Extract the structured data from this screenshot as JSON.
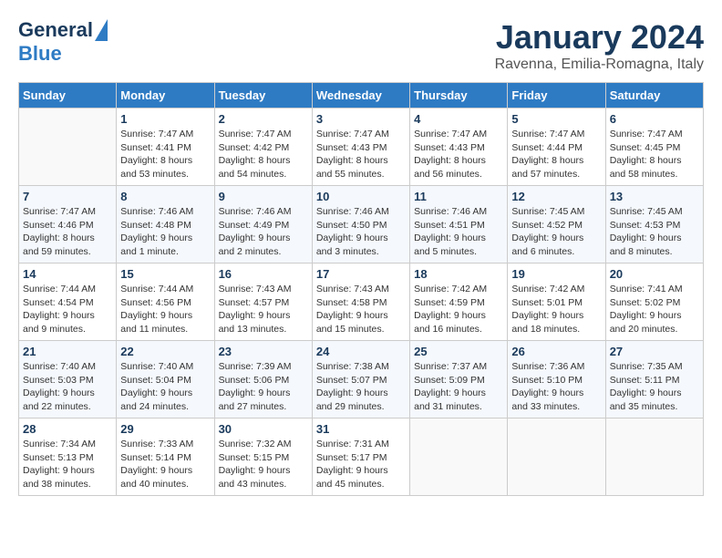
{
  "header": {
    "logo_general": "General",
    "logo_blue": "Blue",
    "month": "January 2024",
    "location": "Ravenna, Emilia-Romagna, Italy"
  },
  "days_of_week": [
    "Sunday",
    "Monday",
    "Tuesday",
    "Wednesday",
    "Thursday",
    "Friday",
    "Saturday"
  ],
  "weeks": [
    [
      {
        "day": "",
        "sunrise": "",
        "sunset": "",
        "daylight": ""
      },
      {
        "day": "1",
        "sunrise": "Sunrise: 7:47 AM",
        "sunset": "Sunset: 4:41 PM",
        "daylight": "Daylight: 8 hours and 53 minutes."
      },
      {
        "day": "2",
        "sunrise": "Sunrise: 7:47 AM",
        "sunset": "Sunset: 4:42 PM",
        "daylight": "Daylight: 8 hours and 54 minutes."
      },
      {
        "day": "3",
        "sunrise": "Sunrise: 7:47 AM",
        "sunset": "Sunset: 4:43 PM",
        "daylight": "Daylight: 8 hours and 55 minutes."
      },
      {
        "day": "4",
        "sunrise": "Sunrise: 7:47 AM",
        "sunset": "Sunset: 4:43 PM",
        "daylight": "Daylight: 8 hours and 56 minutes."
      },
      {
        "day": "5",
        "sunrise": "Sunrise: 7:47 AM",
        "sunset": "Sunset: 4:44 PM",
        "daylight": "Daylight: 8 hours and 57 minutes."
      },
      {
        "day": "6",
        "sunrise": "Sunrise: 7:47 AM",
        "sunset": "Sunset: 4:45 PM",
        "daylight": "Daylight: 8 hours and 58 minutes."
      }
    ],
    [
      {
        "day": "7",
        "sunrise": "Sunrise: 7:47 AM",
        "sunset": "Sunset: 4:46 PM",
        "daylight": "Daylight: 8 hours and 59 minutes."
      },
      {
        "day": "8",
        "sunrise": "Sunrise: 7:46 AM",
        "sunset": "Sunset: 4:48 PM",
        "daylight": "Daylight: 9 hours and 1 minute."
      },
      {
        "day": "9",
        "sunrise": "Sunrise: 7:46 AM",
        "sunset": "Sunset: 4:49 PM",
        "daylight": "Daylight: 9 hours and 2 minutes."
      },
      {
        "day": "10",
        "sunrise": "Sunrise: 7:46 AM",
        "sunset": "Sunset: 4:50 PM",
        "daylight": "Daylight: 9 hours and 3 minutes."
      },
      {
        "day": "11",
        "sunrise": "Sunrise: 7:46 AM",
        "sunset": "Sunset: 4:51 PM",
        "daylight": "Daylight: 9 hours and 5 minutes."
      },
      {
        "day": "12",
        "sunrise": "Sunrise: 7:45 AM",
        "sunset": "Sunset: 4:52 PM",
        "daylight": "Daylight: 9 hours and 6 minutes."
      },
      {
        "day": "13",
        "sunrise": "Sunrise: 7:45 AM",
        "sunset": "Sunset: 4:53 PM",
        "daylight": "Daylight: 9 hours and 8 minutes."
      }
    ],
    [
      {
        "day": "14",
        "sunrise": "Sunrise: 7:44 AM",
        "sunset": "Sunset: 4:54 PM",
        "daylight": "Daylight: 9 hours and 9 minutes."
      },
      {
        "day": "15",
        "sunrise": "Sunrise: 7:44 AM",
        "sunset": "Sunset: 4:56 PM",
        "daylight": "Daylight: 9 hours and 11 minutes."
      },
      {
        "day": "16",
        "sunrise": "Sunrise: 7:43 AM",
        "sunset": "Sunset: 4:57 PM",
        "daylight": "Daylight: 9 hours and 13 minutes."
      },
      {
        "day": "17",
        "sunrise": "Sunrise: 7:43 AM",
        "sunset": "Sunset: 4:58 PM",
        "daylight": "Daylight: 9 hours and 15 minutes."
      },
      {
        "day": "18",
        "sunrise": "Sunrise: 7:42 AM",
        "sunset": "Sunset: 4:59 PM",
        "daylight": "Daylight: 9 hours and 16 minutes."
      },
      {
        "day": "19",
        "sunrise": "Sunrise: 7:42 AM",
        "sunset": "Sunset: 5:01 PM",
        "daylight": "Daylight: 9 hours and 18 minutes."
      },
      {
        "day": "20",
        "sunrise": "Sunrise: 7:41 AM",
        "sunset": "Sunset: 5:02 PM",
        "daylight": "Daylight: 9 hours and 20 minutes."
      }
    ],
    [
      {
        "day": "21",
        "sunrise": "Sunrise: 7:40 AM",
        "sunset": "Sunset: 5:03 PM",
        "daylight": "Daylight: 9 hours and 22 minutes."
      },
      {
        "day": "22",
        "sunrise": "Sunrise: 7:40 AM",
        "sunset": "Sunset: 5:04 PM",
        "daylight": "Daylight: 9 hours and 24 minutes."
      },
      {
        "day": "23",
        "sunrise": "Sunrise: 7:39 AM",
        "sunset": "Sunset: 5:06 PM",
        "daylight": "Daylight: 9 hours and 27 minutes."
      },
      {
        "day": "24",
        "sunrise": "Sunrise: 7:38 AM",
        "sunset": "Sunset: 5:07 PM",
        "daylight": "Daylight: 9 hours and 29 minutes."
      },
      {
        "day": "25",
        "sunrise": "Sunrise: 7:37 AM",
        "sunset": "Sunset: 5:09 PM",
        "daylight": "Daylight: 9 hours and 31 minutes."
      },
      {
        "day": "26",
        "sunrise": "Sunrise: 7:36 AM",
        "sunset": "Sunset: 5:10 PM",
        "daylight": "Daylight: 9 hours and 33 minutes."
      },
      {
        "day": "27",
        "sunrise": "Sunrise: 7:35 AM",
        "sunset": "Sunset: 5:11 PM",
        "daylight": "Daylight: 9 hours and 35 minutes."
      }
    ],
    [
      {
        "day": "28",
        "sunrise": "Sunrise: 7:34 AM",
        "sunset": "Sunset: 5:13 PM",
        "daylight": "Daylight: 9 hours and 38 minutes."
      },
      {
        "day": "29",
        "sunrise": "Sunrise: 7:33 AM",
        "sunset": "Sunset: 5:14 PM",
        "daylight": "Daylight: 9 hours and 40 minutes."
      },
      {
        "day": "30",
        "sunrise": "Sunrise: 7:32 AM",
        "sunset": "Sunset: 5:15 PM",
        "daylight": "Daylight: 9 hours and 43 minutes."
      },
      {
        "day": "31",
        "sunrise": "Sunrise: 7:31 AM",
        "sunset": "Sunset: 5:17 PM",
        "daylight": "Daylight: 9 hours and 45 minutes."
      },
      {
        "day": "",
        "sunrise": "",
        "sunset": "",
        "daylight": ""
      },
      {
        "day": "",
        "sunrise": "",
        "sunset": "",
        "daylight": ""
      },
      {
        "day": "",
        "sunrise": "",
        "sunset": "",
        "daylight": ""
      }
    ]
  ]
}
